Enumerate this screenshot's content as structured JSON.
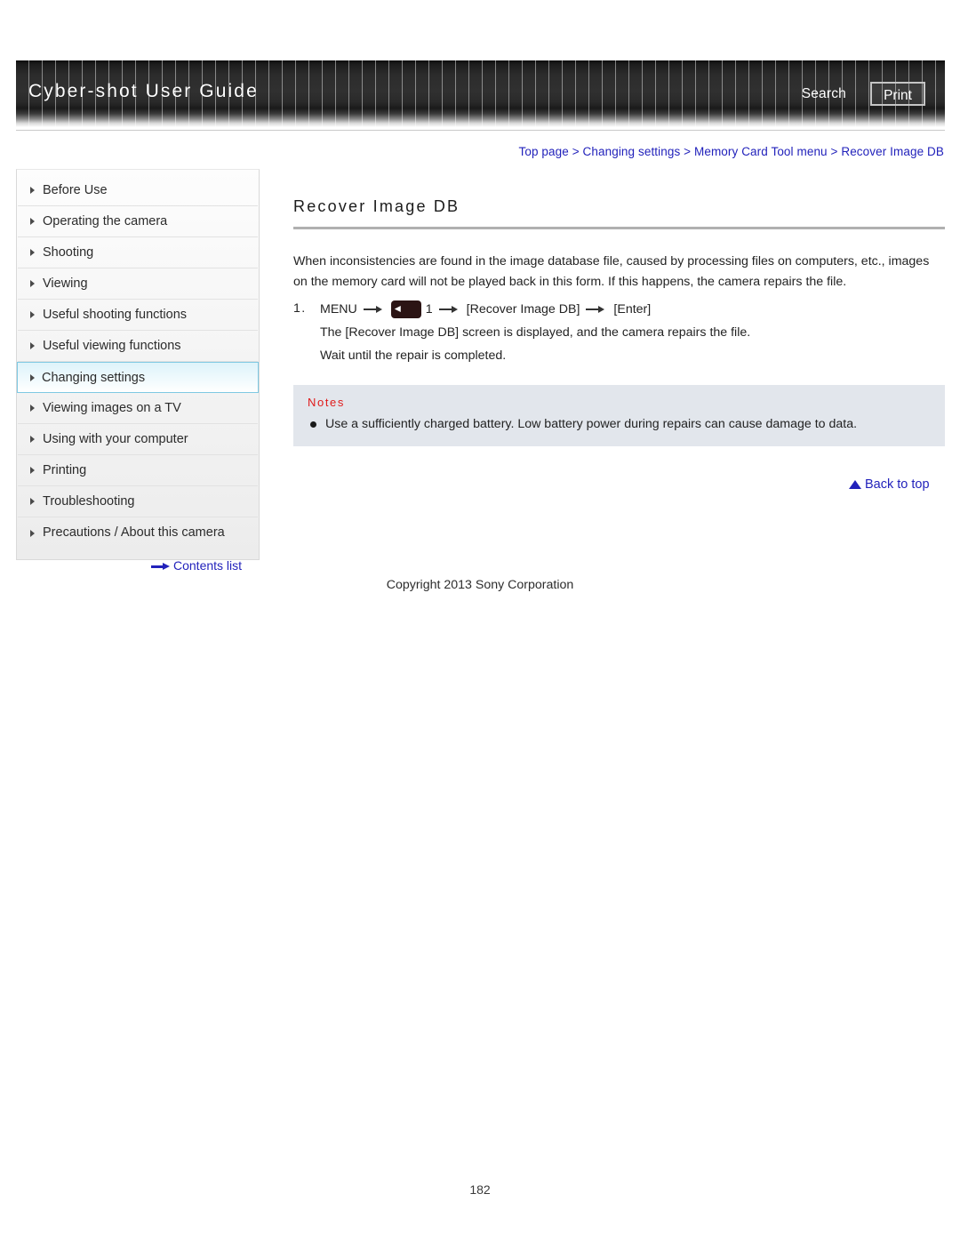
{
  "header": {
    "site_title": "Cyber-shot User Guide",
    "search_label": "Search",
    "print_label": "Print"
  },
  "breadcrumb": {
    "text": "Top page > Changing settings > Memory Card Tool menu > Recover Image DB",
    "color": "#2222bb"
  },
  "sidebar": {
    "items": [
      {
        "label": "Before Use",
        "active": false
      },
      {
        "label": "Operating the camera",
        "active": false
      },
      {
        "label": "Shooting",
        "active": false
      },
      {
        "label": "Viewing",
        "active": false
      },
      {
        "label": "Useful shooting functions",
        "active": false
      },
      {
        "label": "Useful viewing functions",
        "active": false
      },
      {
        "label": "Changing settings",
        "active": true
      },
      {
        "label": "Viewing images on a TV",
        "active": false
      },
      {
        "label": "Using with your computer",
        "active": false
      },
      {
        "label": "Printing",
        "active": false
      },
      {
        "label": "Troubleshooting",
        "active": false
      },
      {
        "label": "Precautions / About this camera",
        "active": false
      }
    ],
    "contents_list_label": "Contents list"
  },
  "main": {
    "title": "Recover Image DB",
    "intro": "When inconsistencies are found in the image database file, caused by processing files on computers, etc., images on the memory card will not be played back in this form. If this happens, the camera repairs the file.",
    "step": {
      "number": "1.",
      "menu_label": "MENU",
      "icon_name": "memory-card-tool-icon",
      "icon_suffix": "1",
      "target_label": "[Recover Image DB]",
      "enter_label": "[Enter]",
      "detail_line1": "The [Recover Image DB] screen is displayed, and the camera repairs the file.",
      "detail_line2": "Wait until the repair is completed."
    },
    "notes": {
      "label": "Notes",
      "label_color": "#e01b1b",
      "items": [
        "Use a sufficiently charged battery. Low battery power during repairs can cause damage to data."
      ]
    },
    "back_to_top_label": "Back to top"
  },
  "footer": {
    "copyright": "Copyright 2013 Sony Corporation",
    "page_number": "182"
  }
}
